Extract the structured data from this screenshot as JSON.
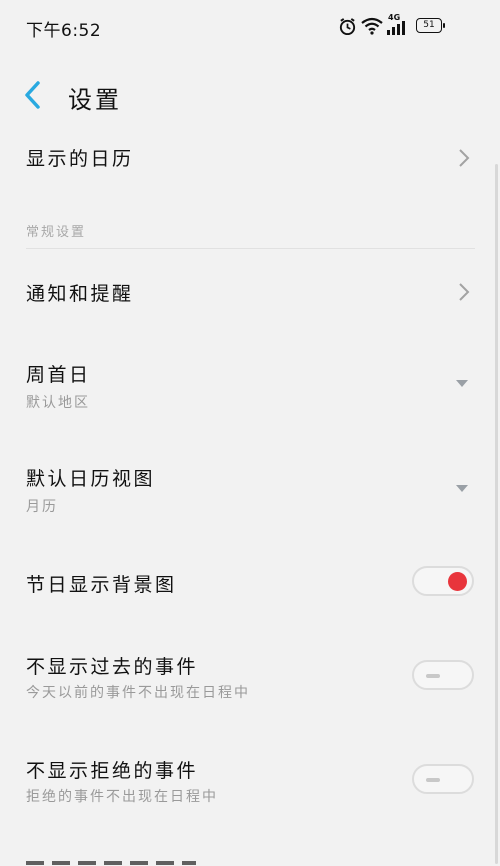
{
  "status_bar": {
    "time": "下午6:52",
    "signal_label": "4G",
    "battery": "51"
  },
  "header": {
    "title": "设置"
  },
  "rows": {
    "calendars": {
      "title": "显示的日历"
    },
    "notifications": {
      "title": "通知和提醒"
    },
    "week_start": {
      "title": "周首日",
      "subtitle": "默认地区"
    },
    "default_view": {
      "title": "默认日历视图",
      "subtitle": "月历"
    },
    "holiday_bg": {
      "title": "节日显示背景图",
      "enabled": true
    },
    "hide_past": {
      "title": "不显示过去的事件",
      "subtitle": "今天以前的事件不出现在日程中",
      "enabled": false
    },
    "hide_declined": {
      "title": "不显示拒绝的事件",
      "subtitle": "拒绝的事件不出现在日程中",
      "enabled": false
    }
  },
  "section": {
    "general": "常规设置"
  },
  "colors": {
    "accent": "#29a9e0",
    "toggle_on": "#e8353c"
  }
}
